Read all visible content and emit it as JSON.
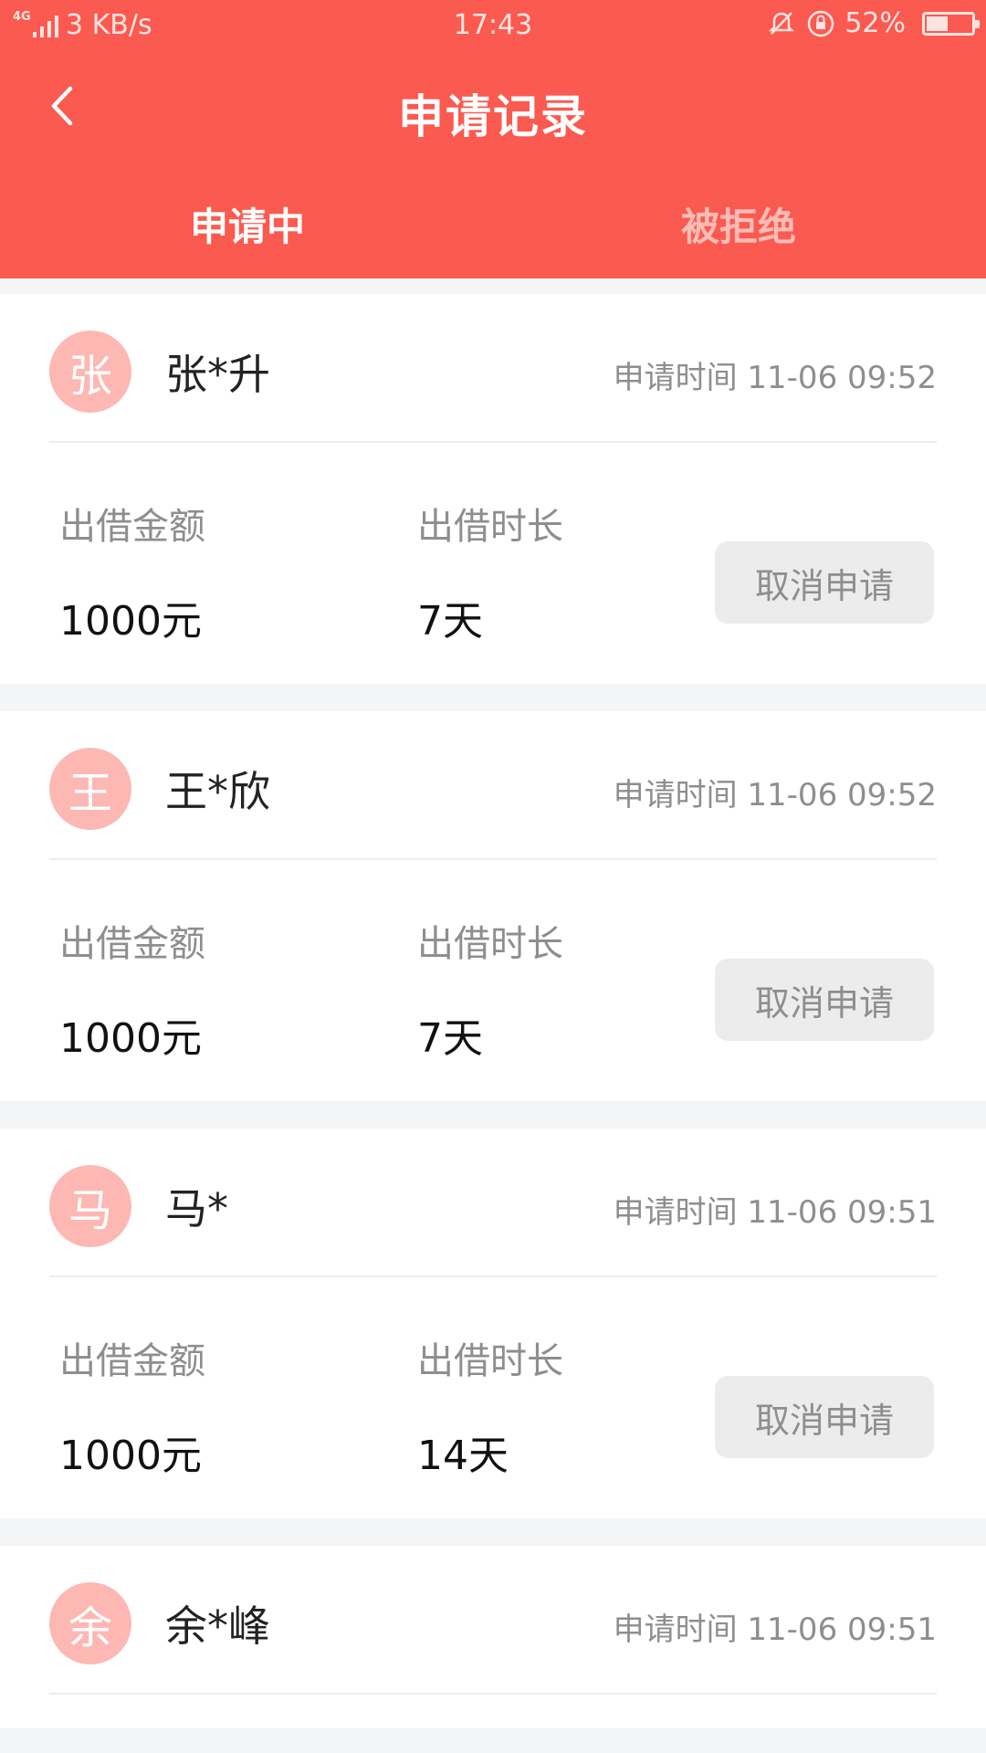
{
  "status_bar": {
    "network": "4G",
    "speed": "3 KB/s",
    "time": "17:43",
    "battery": "52%",
    "battery_level": 0.52
  },
  "header": {
    "title": "申请记录",
    "tabs": [
      {
        "label": "申请中",
        "active": true
      },
      {
        "label": "被拒绝",
        "active": false
      }
    ]
  },
  "labels": {
    "amount": "出借金额",
    "duration": "出借时长",
    "cancel": "取消申请"
  },
  "records": [
    {
      "avatar": "张",
      "name": "张*升",
      "time": "申请时间 11-06 09:52",
      "amount": "1000元",
      "duration": "7天"
    },
    {
      "avatar": "王",
      "name": "王*欣",
      "time": "申请时间 11-06 09:52",
      "amount": "1000元",
      "duration": "7天"
    },
    {
      "avatar": "马",
      "name": "马*",
      "time": "申请时间 11-06 09:51",
      "amount": "1000元",
      "duration": "14天"
    },
    {
      "avatar": "余",
      "name": "余*峰",
      "time": "申请时间 11-06 09:51"
    }
  ],
  "colors": {
    "brand": "#fb5a50",
    "avatar_bg": "#fdb8b4",
    "inactive_tab": "#fbbcb6"
  }
}
